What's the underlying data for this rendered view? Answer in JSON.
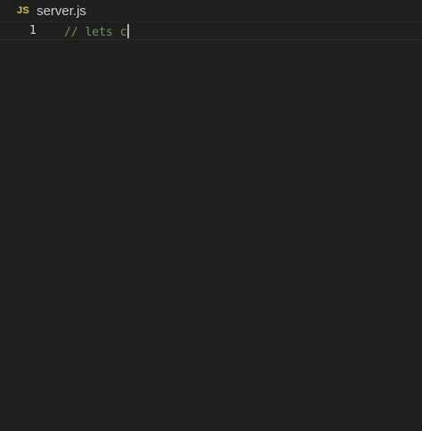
{
  "tab": {
    "icon_text": "JS",
    "filename": "server.js"
  },
  "editor": {
    "lines": [
      {
        "number": "1",
        "text": "// lets c"
      }
    ]
  },
  "colors": {
    "background": "#1f1f1f",
    "js_icon": "#cbcb41",
    "comment": "#6a9955",
    "line_number": "#d4d4d4",
    "cursor": "#aeafad"
  }
}
